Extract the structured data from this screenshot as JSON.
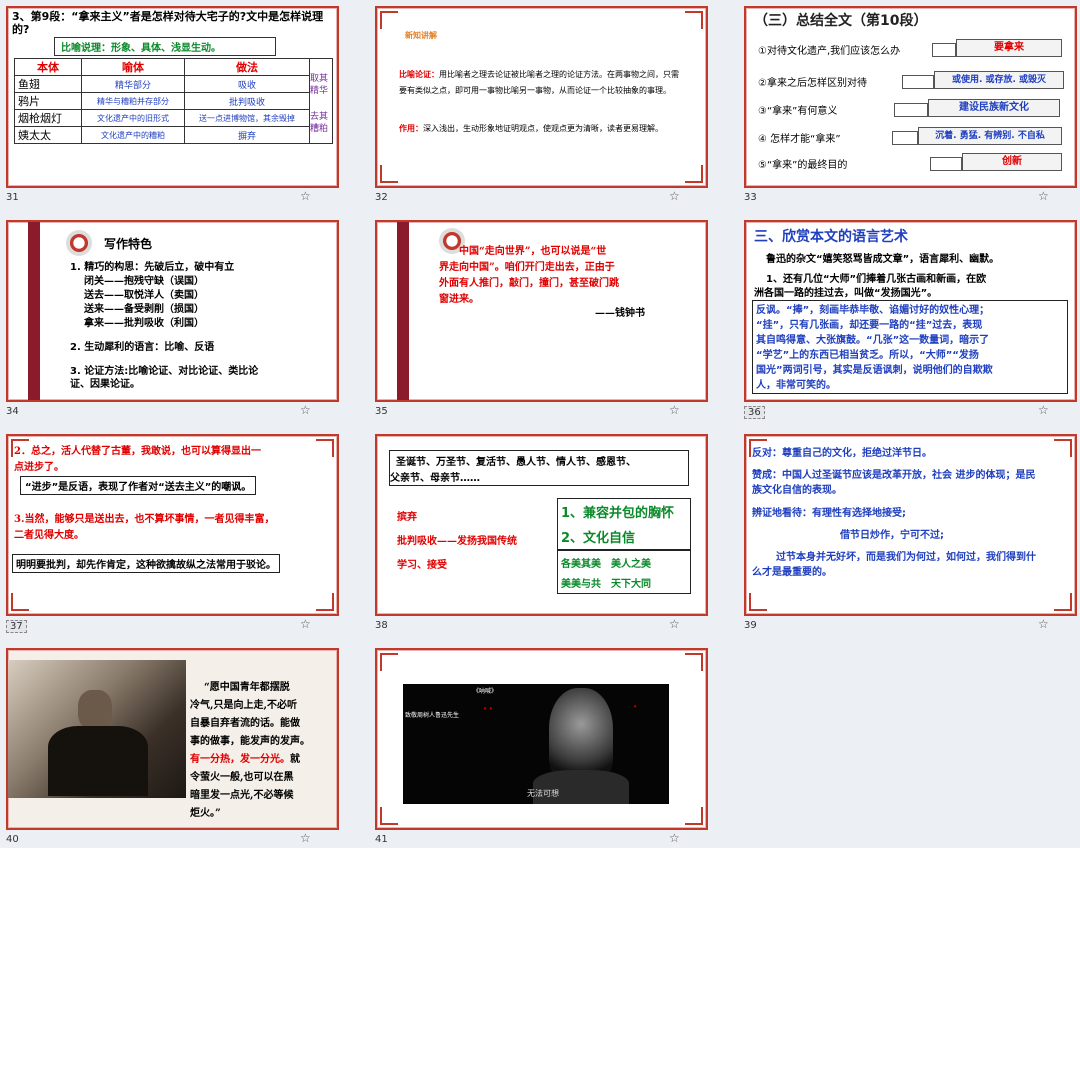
{
  "s31": {
    "title": "3、第9段：“拿来主义”者是怎样对待大宅子的?文中是怎样说理的?",
    "method": "比喻说理：形象、具体、浅显生动。",
    "head": [
      "本体",
      "喻体",
      "做法"
    ],
    "rows": [
      [
        "鱼翅",
        "精华部分",
        "吸收"
      ],
      [
        "鸦片",
        "精华与糟粕并存部分",
        "批判吸收"
      ],
      [
        "烟枪烟灯",
        "文化遗产中的旧形式",
        "送一点进博物馆，其余毁掉"
      ],
      [
        "姨太太",
        "文化遗产中的糟粕",
        "摒弃"
      ]
    ],
    "side1": "取其精华",
    "side2": "去其糟粕",
    "num": "31"
  },
  "s32": {
    "heading": "新知讲解",
    "p1_label": "比喻论证：",
    "p1": "用比喻者之理去论证被比喻者之理的论证方法。在两事物之间，只需要有类似之点，即可用一事物比喻另一事物，从而论证一个比较抽象的事理。",
    "p2_label": "作用：",
    "p2": "深入浅出，生动形象地证明观点，使观点更为清晰，读者更易理解。",
    "num": "32"
  },
  "s33": {
    "title": "（三）总结全文（第10段）",
    "items": [
      {
        "q": "①对待文化遗产,我们应该怎么办",
        "a": "要拿来"
      },
      {
        "q": "②拿来之后怎样区别对待",
        "a": "或使用. 或存放. 或毁灭"
      },
      {
        "q": "③“拿来”有何意义",
        "a": "建设民族新文化"
      },
      {
        "q": "④ 怎样才能“拿来”",
        "a": "沉着. 勇猛. 有辨别. 不自私"
      },
      {
        "q": "⑤“拿来”的最终目的",
        "a": "创新"
      }
    ],
    "num": "33"
  },
  "s34": {
    "title": "写作特色",
    "l1": "1. 精巧的构思：先破后立，破中有立",
    "l1_kw": "构思",
    "l2": "闭关——抱残守缺（误国）",
    "l3": "送去——取悦洋人（卖国）",
    "l4": "送来——备受剥削（损国）",
    "l5": "拿来——批判吸收（利国）",
    "l6": "2. 生动犀利的语言：比喻、反语",
    "l7": "3. 论证方法:比喻论证、对比论证、类比论",
    "l8": "证、因果论证。",
    "num": "34"
  },
  "s35": {
    "l1": "中国“走向世界”，也可以说是“世",
    "l2": "界走向中国”。咱们开门走出去，正由于",
    "l3": "外面有人推门，敲门，撞门，甚至破门跳",
    "l4": "窗进来。",
    "author": "——钱钟书",
    "num": "35"
  },
  "s36": {
    "title": "三、欣赏本文的语言艺术",
    "sub": "鲁迅的杂文“嬉笑怒骂皆成文章”，语言犀利、幽默。",
    "q1": "1、还有几位“大师”们捧着几张古画和新画，在欧",
    "q2": "洲各国一路的挂过去，叫做“发扬国光”。",
    "a1": "反讽。“捧”，刻画毕恭毕敬、谄媚讨好的奴性心理；",
    "a2": "“挂”，只有几张画，却还要一路的“挂”过去，表现",
    "a3": "其自鸣得意、大张旗鼓。“几张”这一数量词，暗示了",
    "a4": "“学艺”上的东西已相当贫乏。所以，“大师”“发扬",
    "a5": "国光”两词引号，其实是反语讽刺，说明他们的自欺欺",
    "a6": "人，非常可笑的。",
    "num": "36"
  },
  "s37": {
    "l1": "2．总之，活人代替了古董，我敢说，也可以算得显出一",
    "l2": "点进步了。",
    "box1": "“进步”是反语，表现了作者对“送去主义”的嘲讽。",
    "l3": "3.当然，能够只是送出去，也不算坏事情，一者见得丰富，",
    "l4": "二者见得大度。",
    "box2": "明明要批判，却先作肯定，这种欲擒故纵之法常用于驳论。",
    "num": "37"
  },
  "s38": {
    "top1": "圣诞节、万圣节、复活节、愚人节、情人节、感恩节、",
    "top2": "父亲节、母亲节……",
    "left1": "摈弃",
    "left2": "批判吸收——发扬我国传统",
    "left3": "学习、接受",
    "r1": "1、兼容并包的胸怀",
    "r2": "2、文化自信",
    "r3": "各美其美　美人之美",
    "r4": "美美与共　天下大同",
    "num": "38"
  },
  "s39": {
    "p1": "反对：尊重自己的文化，拒绝过洋节日。",
    "p2a": "赞成：中国人过圣诞节应该是改革开放，社会 进步的体现；是民",
    "p2b": "族文化自信的表现。",
    "p3": "辨证地看待：有理性有选择地接受;",
    "p4": "借节日炒作，宁可不过;",
    "p5a": "过节本身并无好坏，而是我们为何过，如何过，我们得到什",
    "p5b": "么才是最重要的。",
    "num": "39"
  },
  "s40": {
    "l1": "“愿中国青年都摆脱",
    "l2": "冷气,只是向上走,不必听",
    "l3": "自暴自弃者流的话。能做",
    "l4": "事的做事，能发声的发声。",
    "l5": "有一分热，发一分光。",
    "l5b": "就",
    "l6": "令萤火一般,也可以在黑",
    "l7": "暗里发一点光,不必等候",
    "l8": "炬火。”",
    "num": "40"
  },
  "s41": {
    "c1": "无法可想",
    "c2": "《呐喊》",
    "c3": "致敬周树人鲁迅先生",
    "num": "41"
  }
}
